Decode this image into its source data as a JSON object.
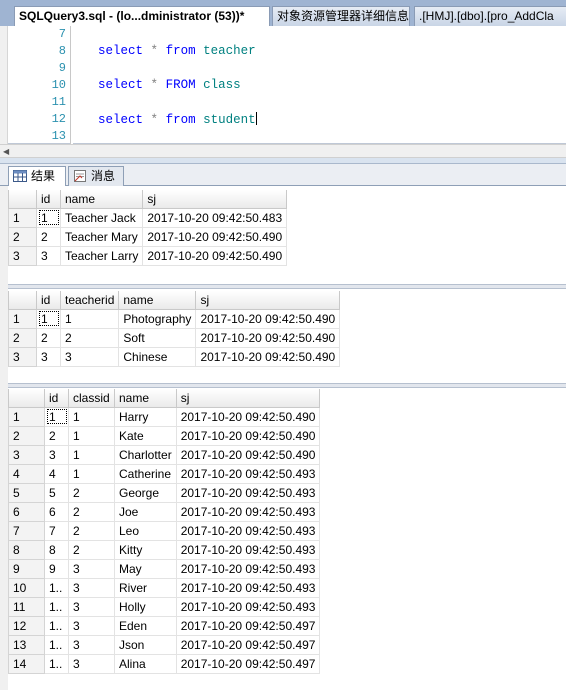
{
  "tabs": [
    {
      "label": "SQLQuery3.sql - (lo...dministrator (53))*",
      "active": true
    },
    {
      "label": "对象资源管理器详细信息",
      "active": false
    },
    {
      "label": ".[HMJ].[dbo].[pro_AddCla",
      "active": false
    }
  ],
  "editor": {
    "line_numbers": [
      "7",
      "8",
      "9",
      "10",
      "11",
      "12",
      "13"
    ],
    "lines": [
      {
        "kw": "select",
        "op": "*",
        "kw2": "from",
        "table": "teacher"
      },
      {
        "kw": "select",
        "op": "*",
        "kw2": "FROM",
        "table": "class"
      },
      {
        "kw": "select",
        "op": "*",
        "kw2": "from",
        "table": "student"
      }
    ]
  },
  "result_tabs": [
    {
      "label": "结果",
      "icon": "grid-icon",
      "active": true
    },
    {
      "label": "消息",
      "icon": "message-icon",
      "active": false
    }
  ],
  "grids": [
    {
      "columns": [
        "",
        "id",
        "name",
        "sj"
      ],
      "rows": [
        [
          "1",
          "1",
          "Teacher Jack",
          "2017-10-20 09:42:50.483"
        ],
        [
          "2",
          "2",
          "Teacher Mary",
          "2017-10-20 09:42:50.490"
        ],
        [
          "3",
          "3",
          "Teacher Larry",
          "2017-10-20 09:42:50.490"
        ]
      ]
    },
    {
      "columns": [
        "",
        "id",
        "teacherid",
        "name",
        "sj"
      ],
      "rows": [
        [
          "1",
          "1",
          "1",
          "Photography",
          "2017-10-20 09:42:50.490"
        ],
        [
          "2",
          "2",
          "2",
          "Soft",
          "2017-10-20 09:42:50.490"
        ],
        [
          "3",
          "3",
          "3",
          "Chinese",
          "2017-10-20 09:42:50.490"
        ]
      ]
    },
    {
      "columns": [
        "",
        "id",
        "classid",
        "name",
        "sj"
      ],
      "rows": [
        [
          "1",
          "1",
          "1",
          "Harry",
          "2017-10-20 09:42:50.490"
        ],
        [
          "2",
          "2",
          "1",
          "Kate",
          "2017-10-20 09:42:50.490"
        ],
        [
          "3",
          "3",
          "1",
          "Charlotter",
          "2017-10-20 09:42:50.490"
        ],
        [
          "4",
          "4",
          "1",
          "Catherine",
          "2017-10-20 09:42:50.493"
        ],
        [
          "5",
          "5",
          "2",
          "George",
          "2017-10-20 09:42:50.493"
        ],
        [
          "6",
          "6",
          "2",
          "Joe",
          "2017-10-20 09:42:50.493"
        ],
        [
          "7",
          "7",
          "2",
          "Leo",
          "2017-10-20 09:42:50.493"
        ],
        [
          "8",
          "8",
          "2",
          "Kitty",
          "2017-10-20 09:42:50.493"
        ],
        [
          "9",
          "9",
          "3",
          "May",
          "2017-10-20 09:42:50.493"
        ],
        [
          "10",
          "1..",
          "3",
          "River",
          "2017-10-20 09:42:50.493"
        ],
        [
          "11",
          "1..",
          "3",
          "Holly",
          "2017-10-20 09:42:50.493"
        ],
        [
          "12",
          "1..",
          "3",
          "Eden",
          "2017-10-20 09:42:50.497"
        ],
        [
          "13",
          "1..",
          "3",
          "Json",
          "2017-10-20 09:42:50.497"
        ],
        [
          "14",
          "1..",
          "3",
          "Alina",
          "2017-10-20 09:42:50.497"
        ]
      ]
    }
  ]
}
